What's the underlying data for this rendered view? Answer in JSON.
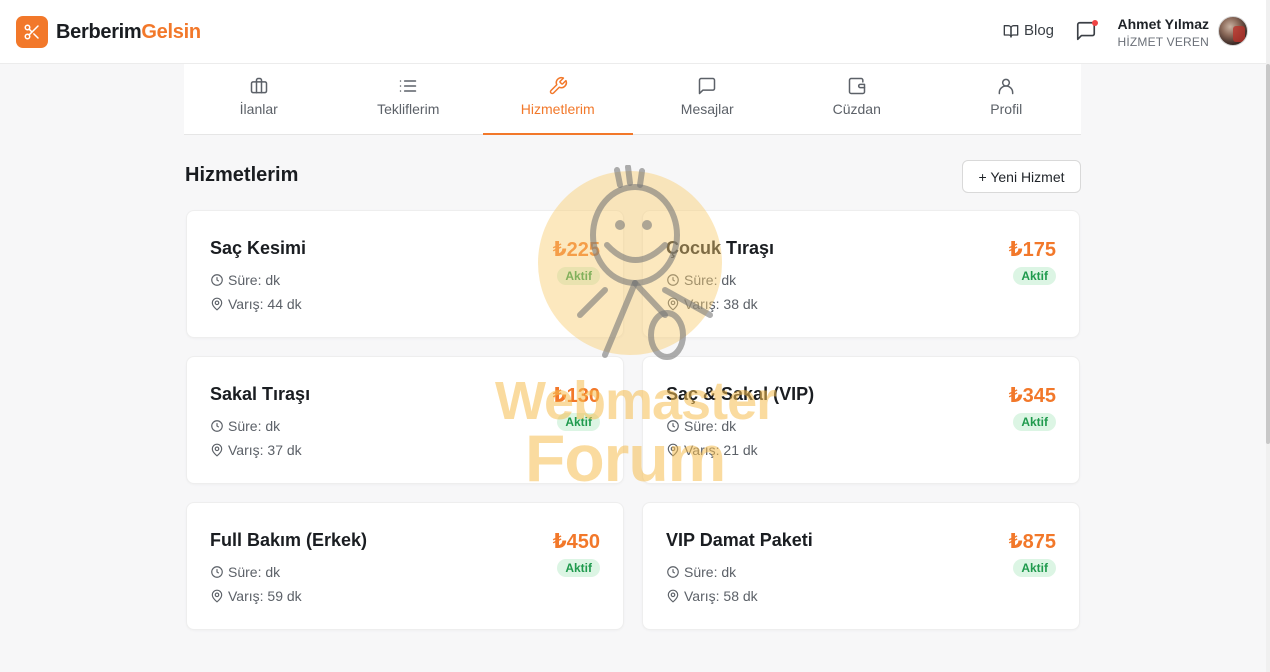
{
  "header": {
    "logo_part1": "Berberim",
    "logo_part2": "Gelsin",
    "blog_label": "Blog",
    "user_name": "Ahmet Yılmaz",
    "user_role": "HİZMET VEREN"
  },
  "tabs": [
    {
      "label": "İlanlar",
      "icon": "briefcase-icon"
    },
    {
      "label": "Tekliflerim",
      "icon": "list-icon"
    },
    {
      "label": "Hizmetlerim",
      "icon": "wrench-icon",
      "active": true
    },
    {
      "label": "Mesajlar",
      "icon": "message-icon"
    },
    {
      "label": "Cüzdan",
      "icon": "wallet-icon"
    },
    {
      "label": "Profil",
      "icon": "user-icon"
    }
  ],
  "page": {
    "title": "Hizmetlerim",
    "new_button": "+ Yeni Hizmet"
  },
  "services": [
    {
      "name": "Saç Kesimi",
      "price": "₺225",
      "status": "Aktif",
      "duration": "Süre: dk",
      "arrival": "Varış: 44 dk"
    },
    {
      "name": "Çocuk Tıraşı",
      "price": "₺175",
      "status": "Aktif",
      "duration": "Süre: dk",
      "arrival": "Varış: 38 dk"
    },
    {
      "name": "Sakal Tıraşı",
      "price": "₺130",
      "status": "Aktif",
      "duration": "Süre: dk",
      "arrival": "Varış: 37 dk"
    },
    {
      "name": "Saç & Sakal (VIP)",
      "price": "₺345",
      "status": "Aktif",
      "duration": "Süre: dk",
      "arrival": "Varış: 21 dk"
    },
    {
      "name": "Full Bakım (Erkek)",
      "price": "₺450",
      "status": "Aktif",
      "duration": "Süre: dk",
      "arrival": "Varış: 59 dk"
    },
    {
      "name": "VIP Damat Paketi",
      "price": "₺875",
      "status": "Aktif",
      "duration": "Süre: dk",
      "arrival": "Varış: 58 dk"
    }
  ],
  "watermark": {
    "line1": "Webmaster",
    "line2": "Forum"
  },
  "colors": {
    "brand": "#f2782a",
    "active_badge_bg": "#dcf5e4",
    "active_badge_text": "#1f9a4d",
    "notification_dot": "#ef4444"
  }
}
